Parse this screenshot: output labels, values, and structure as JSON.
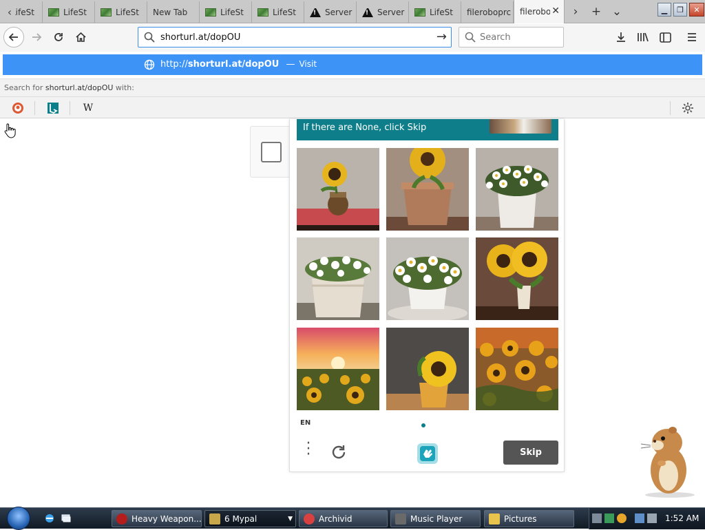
{
  "tabs": {
    "items": [
      {
        "label": "LifeSt",
        "favicon": "money-icon",
        "active": false
      },
      {
        "label": "LifeSt",
        "favicon": "money-icon",
        "active": false
      },
      {
        "label": "LifeSt",
        "favicon": "money-icon",
        "active": false
      },
      {
        "label": "New Tab",
        "favicon": "",
        "active": false
      },
      {
        "label": "LifeSt",
        "favicon": "money-icon",
        "active": false
      },
      {
        "label": "LifeSt",
        "favicon": "money-icon",
        "active": false
      },
      {
        "label": "Server",
        "favicon": "warning-icon",
        "active": false
      },
      {
        "label": "Server",
        "favicon": "warning-icon",
        "active": false
      },
      {
        "label": "LifeSt",
        "favicon": "money-icon",
        "active": false
      },
      {
        "label": "fileroboprc",
        "favicon": "",
        "active": false
      },
      {
        "label": "fileroboprc",
        "favicon": "",
        "active": true
      }
    ],
    "close_glyph": "✕",
    "new_tab_glyph": "+"
  },
  "navbar": {
    "url_value": "shorturl.at/dopOU",
    "search_placeholder": "Search"
  },
  "dropdown": {
    "url_prefix": "http://",
    "url_bold": "shorturl.at/dopOU",
    "dash": "—",
    "visit": "Visit",
    "search_with_prefix": "Search for",
    "search_with_query": "shorturl.at/dopOU",
    "search_with_suffix": "with:",
    "engines": [
      "duckduckgo-icon",
      "bing-icon",
      "wikipedia-icon"
    ],
    "wikipedia_glyph": "W"
  },
  "captcha": {
    "prompt": "If there are None, click Skip",
    "images": [
      "sunflower-vase",
      "sunflower-pot",
      "daisy-pot",
      "daisy-pot",
      "daisy-pot",
      "sunflower-vase",
      "sunflower-field-sunset",
      "sunflower-vase",
      "sunflower-field"
    ],
    "language": "EN",
    "skip_label": "Skip"
  },
  "taskbar": {
    "tasks": [
      {
        "label": "Heavy Weapon...",
        "icon": "weapon-icon",
        "color": "#b51c1c"
      },
      {
        "label": "6 Mypal",
        "icon": "mypal-icon",
        "color": "#c8a64a"
      },
      {
        "label": "Archivid",
        "icon": "archivid-icon",
        "color": "#d94040"
      },
      {
        "label": "Music Player",
        "icon": "music-player-icon",
        "color": "#6a6a6a"
      },
      {
        "label": "Pictures",
        "icon": "folder-icon",
        "color": "#e8c44c"
      }
    ],
    "clock": "1:52 AM"
  },
  "colors": {
    "accent": "#3d94f6",
    "captcha_teal": "#0e7f8a",
    "skip_gray": "#555555"
  }
}
